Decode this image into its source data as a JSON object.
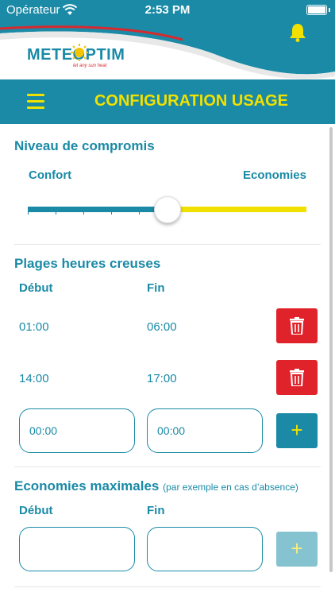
{
  "status_bar": {
    "carrier": "Opérateur",
    "time": "2:53 PM"
  },
  "brand": {
    "logo_text": "METEOPTIM",
    "tagline": "let any sun heat"
  },
  "title_bar": {
    "title": "CONFIGURATION USAGE"
  },
  "compromise": {
    "title": "Niveau de compromis",
    "left_label": "Confort",
    "right_label": "Economies",
    "level": 0.5
  },
  "off_peak": {
    "title": "Plages heures creuses",
    "start_header": "Début",
    "end_header": "Fin",
    "rows": [
      {
        "start": "01:00",
        "end": "06:00"
      },
      {
        "start": "14:00",
        "end": "17:00"
      }
    ],
    "new_start_placeholder": "00:00",
    "new_end_placeholder": "00:00"
  },
  "max_savings": {
    "title": "Economies maximales",
    "note": "(par exemple en cas d’absence)",
    "start_header": "Début",
    "end_header": "Fin",
    "new_start_value": "",
    "new_end_value": ""
  },
  "colors": {
    "primary": "#1a8aa6",
    "accent": "#f1e100",
    "danger": "#e0232b"
  },
  "icons": {
    "menu": "hamburger-icon",
    "notification": "bell-icon",
    "delete": "trash-icon",
    "add": "plus-icon"
  }
}
